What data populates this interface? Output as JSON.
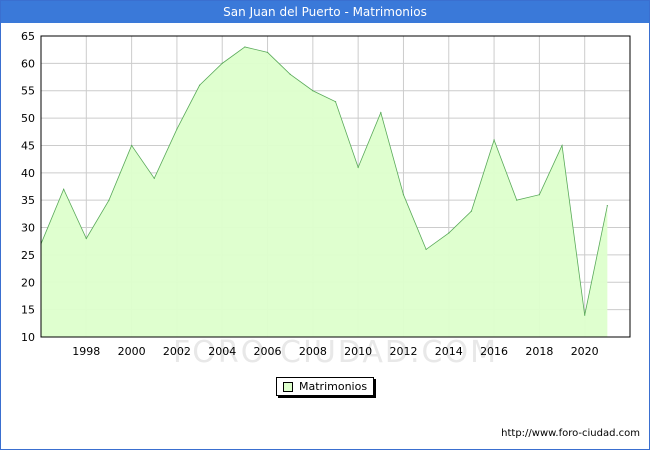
{
  "header": {
    "title": "San Juan del Puerto - Matrimonios"
  },
  "footer": {
    "url": "http://www.foro-ciudad.com"
  },
  "watermark": {
    "text": "FORO-CIUDAD.COM"
  },
  "colors": {
    "title_bar": "#3a79d9",
    "area_fill": "#ddffcc",
    "area_line": "#5aaa5a",
    "grid": "#cccccc"
  },
  "chart_data": {
    "type": "area",
    "title": "San Juan del Puerto - Matrimonios",
    "xlabel": "",
    "ylabel": "",
    "x": [
      1996,
      1997,
      1998,
      1999,
      2000,
      2001,
      2002,
      2003,
      2004,
      2005,
      2006,
      2007,
      2008,
      2009,
      2010,
      2011,
      2012,
      2013,
      2014,
      2015,
      2016,
      2017,
      2018,
      2019,
      2020,
      2021
    ],
    "series": [
      {
        "name": "Matrimonios",
        "values": [
          27,
          37,
          28,
          35,
          45,
          39,
          48,
          56,
          60,
          63,
          62,
          58,
          55,
          53,
          41,
          51,
          36,
          26,
          29,
          33,
          46,
          35,
          36,
          45,
          14,
          34
        ]
      }
    ],
    "xlim": [
      1996,
      2022
    ],
    "ylim": [
      10,
      65
    ],
    "x_ticks": [
      "1998",
      "2000",
      "2002",
      "2004",
      "2006",
      "2008",
      "2010",
      "2012",
      "2014",
      "2016",
      "2018",
      "2020"
    ],
    "y_ticks": [
      "10",
      "15",
      "20",
      "25",
      "30",
      "35",
      "40",
      "45",
      "50",
      "55",
      "60",
      "65"
    ],
    "grid": true,
    "legend_position": "bottom-center"
  }
}
